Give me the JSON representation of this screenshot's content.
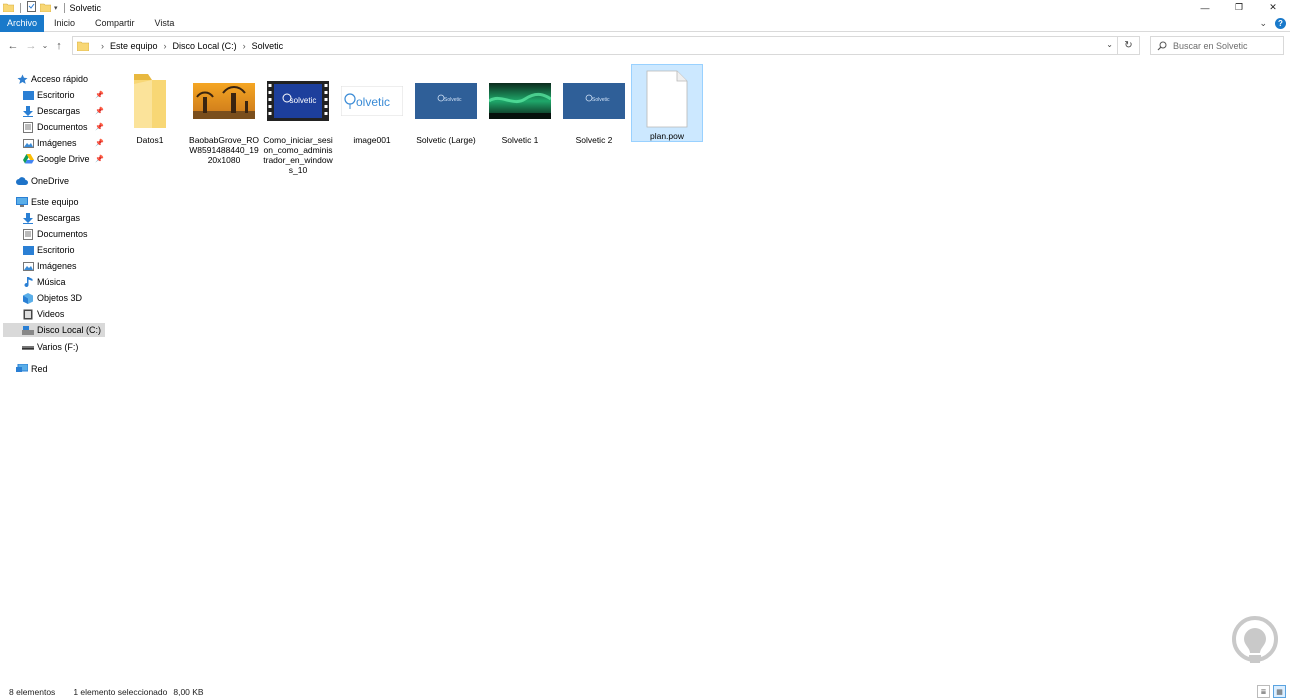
{
  "window": {
    "title": "Solvetic",
    "minimize": "—",
    "maximize": "❐",
    "close": "✕"
  },
  "ribbon": {
    "tabs": [
      "Archivo",
      "Inicio",
      "Compartir",
      "Vista"
    ],
    "collapse": "⌄",
    "help": "?"
  },
  "address": {
    "back": "←",
    "forward": "→",
    "recent": "⌄",
    "up": "↑",
    "crumbs": [
      "Este equipo",
      "Disco Local (C:)",
      "Solvetic"
    ],
    "separator": "›",
    "dropdown": "⌄",
    "refresh": "↻"
  },
  "search": {
    "placeholder": "Buscar en Solvetic"
  },
  "navpane": {
    "quick_access": "Acceso rápido",
    "quick_items": [
      "Escritorio",
      "Descargas",
      "Documentos",
      "Imágenes",
      "Google Drive"
    ],
    "pin": "📌",
    "onedrive": "OneDrive",
    "this_pc": "Este equipo",
    "pc_items": [
      "Descargas",
      "Documentos",
      "Escritorio",
      "Imágenes",
      "Música",
      "Objetos 3D",
      "Videos",
      "Disco Local (C:)",
      "Varios (F:)"
    ],
    "network": "Red"
  },
  "files": [
    {
      "name": "Datos1",
      "type": "folder"
    },
    {
      "name": "BaobabGrove_ROW8591488440_1920x1080",
      "type": "image-baobab"
    },
    {
      "name": "Como_iniciar_sesion_como_administrador_en_windows_10",
      "type": "video"
    },
    {
      "name": "image001",
      "type": "image-solvetic-white"
    },
    {
      "name": "Solvetic (Large)",
      "type": "image-solvetic-blue"
    },
    {
      "name": "Solvetic 1",
      "type": "image-aurora"
    },
    {
      "name": "Solvetic 2",
      "type": "image-solvetic-blue"
    },
    {
      "name": "plan.pow",
      "type": "blank",
      "selected": true
    }
  ],
  "thumb_text": {
    "solvetic": "solvetic",
    "solvetic_small": "Solvetic",
    "solvetic_partial": "olvetic"
  },
  "status": {
    "count": "8 elementos",
    "selection": "1 elemento seleccionado",
    "size": "8,00 KB",
    "view_details": "≣",
    "view_icons": "▦"
  },
  "colors": {
    "accent": "#1979ca",
    "folder": "#f8d775",
    "selection_bg": "#cce8ff",
    "selection_border": "#99d1ff",
    "solvetic_blue": "#2f5f98"
  }
}
